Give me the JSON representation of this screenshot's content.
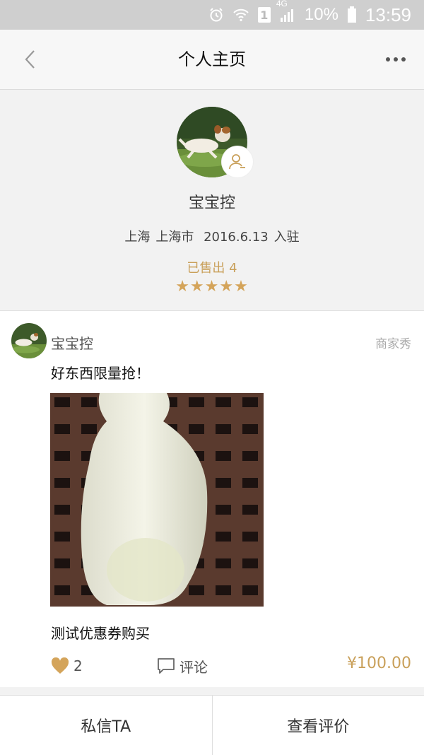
{
  "status_bar": {
    "network": "4G",
    "sim_slot": "1",
    "battery": "10%",
    "time": "13:59",
    "icons": [
      "alarm-icon",
      "wifi-icon",
      "sim-icon",
      "signal-icon",
      "battery-icon"
    ]
  },
  "header": {
    "title": "个人主页",
    "back_icon": "chevron-left-icon",
    "more_icon": "more-dots-icon"
  },
  "profile": {
    "name": "宝宝控",
    "province": "上海",
    "city": "上海市",
    "joined_date": "2016.6.13",
    "joined_suffix": "入驻",
    "sold_text": "已售出 4",
    "rating_stars": "★★★★★",
    "rating": 5,
    "follow_icon": "user-minus-icon"
  },
  "post": {
    "author": "宝宝控",
    "tag": "商家秀",
    "text": "好东西限量抢！",
    "item_title": "测试优惠券购买",
    "likes": "2",
    "comment_label": "评论",
    "price": "¥100.00",
    "like_icon": "heart-icon",
    "comment_icon": "comment-icon"
  },
  "bottom_bar": {
    "message_label": "私信TA",
    "reviews_label": "查看评价"
  },
  "colors": {
    "accent": "#c9a05a",
    "star": "#d4a45a",
    "status_bar": "#cfcfcf"
  }
}
